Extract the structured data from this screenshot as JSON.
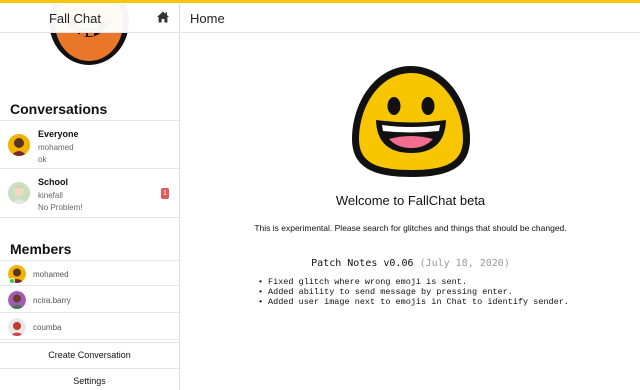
{
  "app": {
    "title": "Fall Chat",
    "accent_color": "#f7c600"
  },
  "sidebar": {
    "home_icon": "home-icon",
    "conversations_title": "Conversations",
    "conversations": [
      {
        "name": "Everyone",
        "last_sender": "mohamed",
        "last_message": "ok",
        "unread": ""
      },
      {
        "name": "School",
        "last_sender": "kinefall",
        "last_message": "No Problem!",
        "unread": "1"
      }
    ],
    "members_title": "Members",
    "members": [
      {
        "name": "mohamed",
        "online": true
      },
      {
        "name": "ncira.barry",
        "online": false
      },
      {
        "name": "coumba",
        "online": false
      }
    ],
    "create_conversation_label": "Create Conversation",
    "settings_label": "Settings"
  },
  "main": {
    "page_title": "Home",
    "welcome": "Welcome to FallChat beta",
    "description": "This is experimental. Please search for glitches and things that should be changed.",
    "patch_notes_title": "Patch Notes v0.06",
    "patch_notes_date": "(July 18, 2020)",
    "patch_notes": [
      "Fixed glitch where wrong emoji is sent.",
      "Added ability to send message by pressing enter.",
      "Added user image next to emojis in Chat to identify sender."
    ]
  }
}
